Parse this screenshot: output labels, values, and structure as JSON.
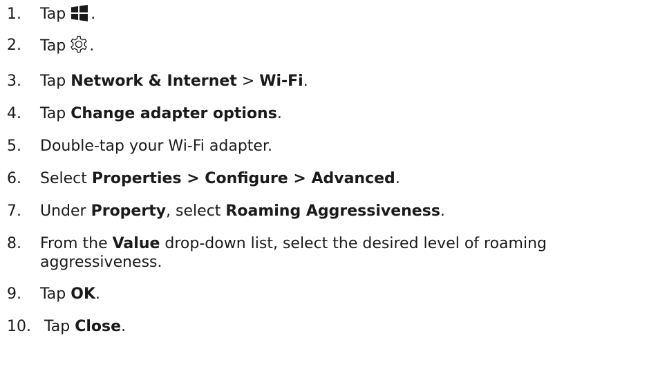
{
  "steps": [
    {
      "num": "1.",
      "parts": [
        "Tap",
        ".",
        ""
      ]
    },
    {
      "num": "2.",
      "parts": [
        "Tap",
        "."
      ]
    },
    {
      "num": "3.",
      "parts": [
        "Tap ",
        "Network & Internet",
        " > ",
        "Wi-Fi",
        "."
      ]
    },
    {
      "num": "4.",
      "parts": [
        "Tap ",
        "Change adapter options",
        "."
      ]
    },
    {
      "num": "5.",
      "parts": [
        "Double-tap your Wi-Fi adapter."
      ]
    },
    {
      "num": "6.",
      "parts": [
        "Select ",
        "Properties > Configure > Advanced",
        "."
      ]
    },
    {
      "num": "7.",
      "parts": [
        "Under ",
        "Property",
        ", select ",
        "Roaming Aggressiveness",
        "."
      ]
    },
    {
      "num": "8.",
      "parts": [
        "From the ",
        "Value",
        " drop-down list, select the desired level of roaming aggressiveness."
      ]
    },
    {
      "num": "9.",
      "parts": [
        "Tap ",
        "OK",
        "."
      ]
    },
    {
      "num": "10.",
      "parts": [
        "Tap ",
        "Close",
        "."
      ]
    }
  ],
  "icons": {
    "start": "windows-start-icon",
    "settings": "settings-gear-icon",
    "icon_color": "#1a1a1a"
  }
}
